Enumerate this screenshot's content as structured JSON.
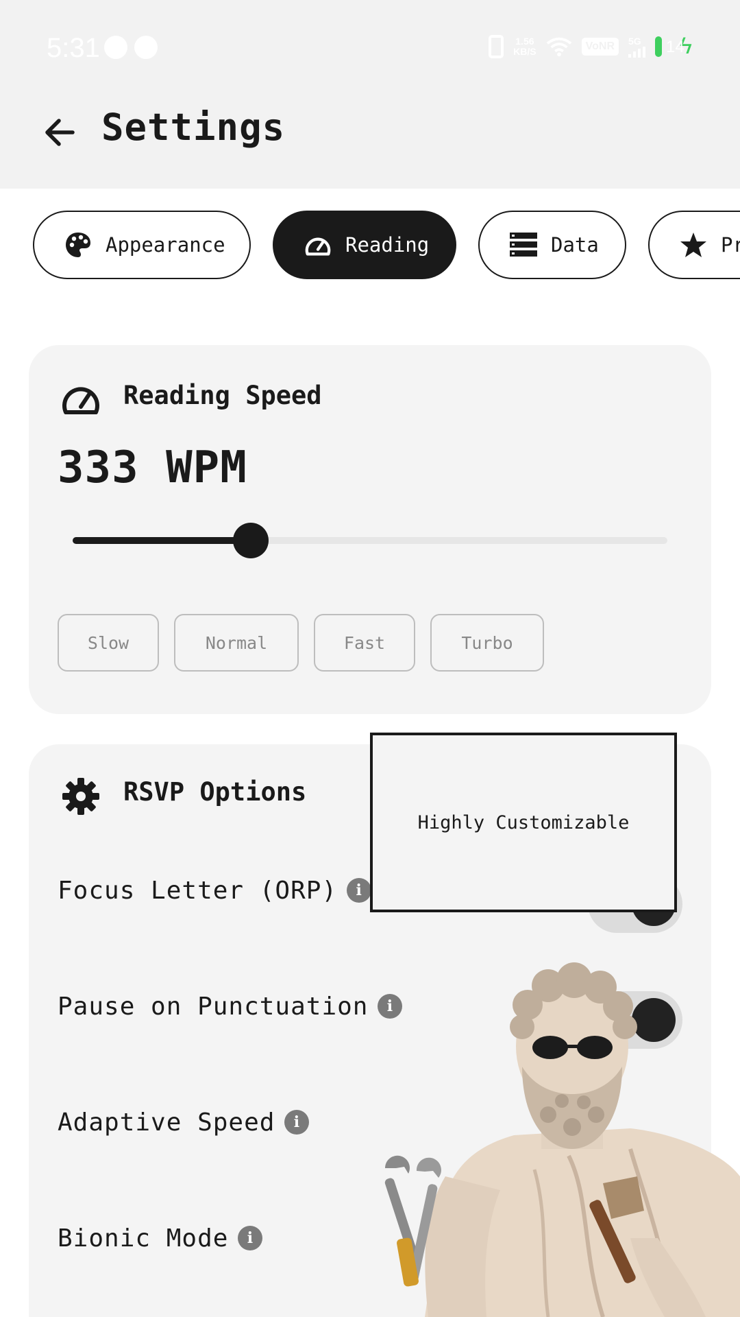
{
  "status_bar": {
    "time": "5:31",
    "net_speed_value": "1.56",
    "net_speed_unit": "KB/S",
    "volte": "VoNR",
    "network": "5G",
    "battery": "14"
  },
  "header": {
    "title": "Settings"
  },
  "tabs": [
    {
      "label": "Appearance",
      "icon": "palette-icon",
      "active": false
    },
    {
      "label": "Reading",
      "icon": "speedometer-icon",
      "active": true
    },
    {
      "label": "Data",
      "icon": "list-icon",
      "active": false
    },
    {
      "label": "Pr",
      "icon": "star-icon",
      "active": false
    }
  ],
  "reading_speed": {
    "title": "Reading Speed",
    "wpm_label": "333 WPM",
    "slider_fraction": 0.3,
    "presets": [
      "Slow",
      "Normal",
      "Fast",
      "Turbo"
    ]
  },
  "rsvp": {
    "title": "RSVP Options",
    "options": [
      {
        "label": "Focus Letter (ORP)",
        "enabled": true
      },
      {
        "label": "Pause on Punctuation",
        "enabled": true
      },
      {
        "label": "Adaptive Speed"
      },
      {
        "label": "Bionic Mode"
      }
    ]
  },
  "tooltip": {
    "text": "Highly Customizable"
  },
  "colors": {
    "accent": "#1a1a1a",
    "charging": "#3ecf5e"
  }
}
